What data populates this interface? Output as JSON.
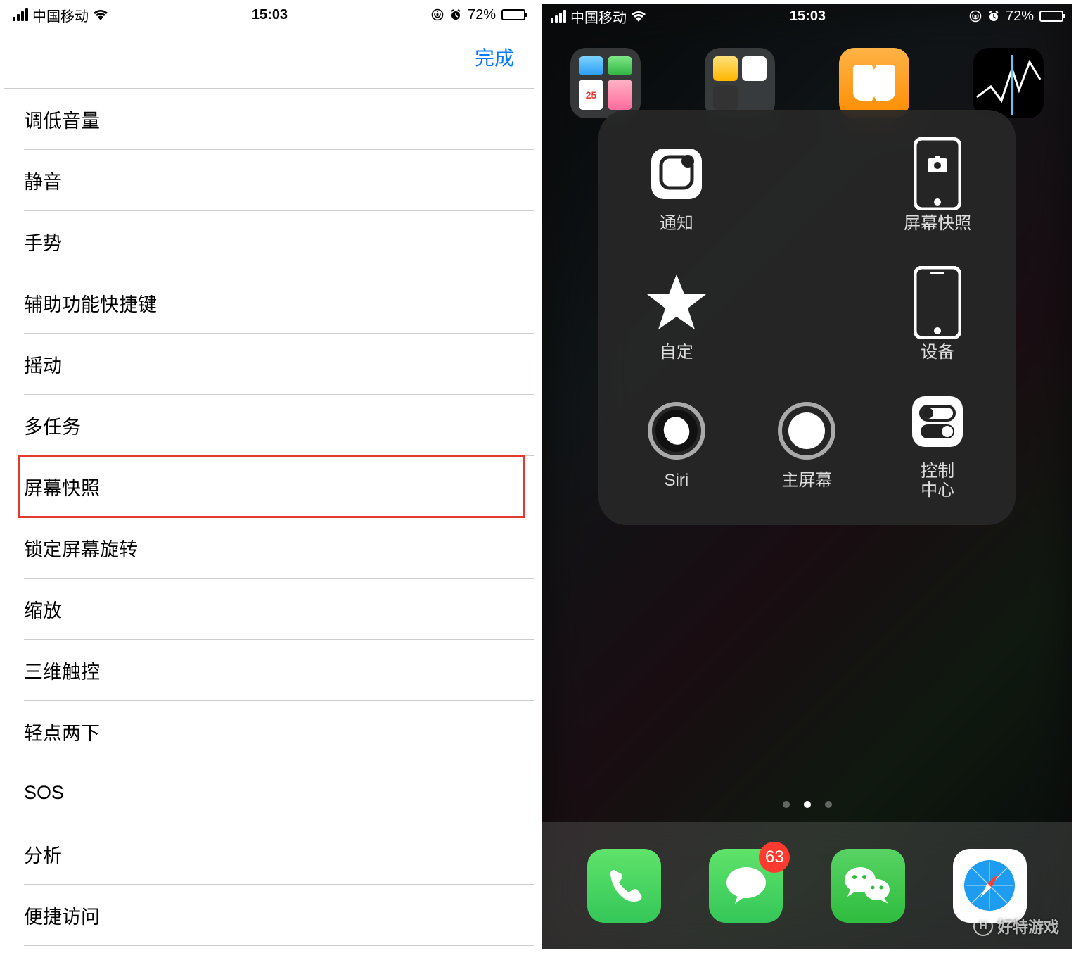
{
  "left": {
    "status": {
      "carrier": "中国移动",
      "time": "15:03",
      "battery_pct": "72%"
    },
    "header": {
      "done_label": "完成"
    },
    "rows": [
      {
        "label": "调低音量"
      },
      {
        "label": "静音"
      },
      {
        "label": "手势"
      },
      {
        "label": "辅助功能快捷键"
      },
      {
        "label": "摇动"
      },
      {
        "label": "多任务"
      },
      {
        "label": "屏幕快照",
        "highlight": true
      },
      {
        "label": "锁定屏幕旋转"
      },
      {
        "label": "缩放"
      },
      {
        "label": "三维触控"
      },
      {
        "label": "轻点两下"
      },
      {
        "label": "SOS"
      },
      {
        "label": "分析"
      },
      {
        "label": "便捷访问"
      }
    ]
  },
  "right": {
    "status": {
      "carrier": "中国移动",
      "time": "15:03",
      "battery_pct": "72%"
    },
    "assistivetouch": {
      "notification": "通知",
      "screenshot": "屏幕快照",
      "custom": "自定",
      "device": "设备",
      "siri": "Siri",
      "home": "主屏幕",
      "control_center": "控制\n中心"
    },
    "dock": {
      "messages_badge": "63"
    },
    "page_indicator": {
      "total": 3,
      "active_index": 1
    },
    "watermark": {
      "badge": "H",
      "text": "好特游戏"
    }
  }
}
